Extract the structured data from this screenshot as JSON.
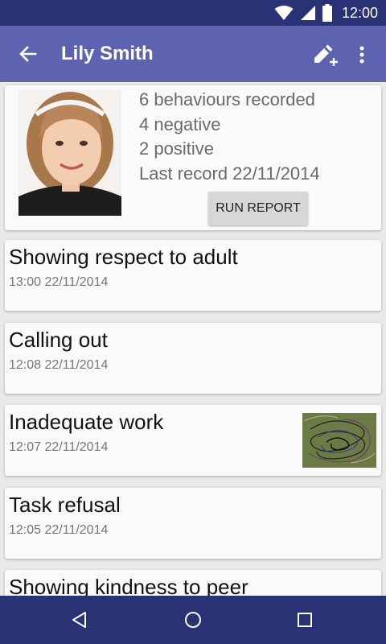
{
  "status_bar": {
    "time": "12:00"
  },
  "app_bar": {
    "title": "Lily Smith"
  },
  "profile": {
    "behaviours": "6 behaviours recorded",
    "negative": "4 negative",
    "positive": "2 positive",
    "last_record": "Last record 22/11/2014",
    "report_button": "RUN REPORT"
  },
  "records": [
    {
      "title": "Showing respect to adult",
      "time": "13:00 22/11/2014"
    },
    {
      "title": "Calling out",
      "time": "12:08 22/11/2014"
    },
    {
      "title": "Inadequate work",
      "time": "12:07 22/11/2014"
    },
    {
      "title": "Task refusal",
      "time": "12:05 22/11/2014"
    },
    {
      "title": "Showing kindness to peer",
      "time": ""
    }
  ],
  "colors": {
    "status_bar": "#2a3276",
    "app_bar": "#5d63b1",
    "background": "#e9e9e9",
    "card": "#fafafa"
  },
  "icons": [
    "wifi-icon",
    "signal-icon",
    "battery-icon",
    "back-arrow-icon",
    "add-record-icon",
    "more-vert-icon",
    "nav-back-icon",
    "nav-home-icon",
    "nav-recents-icon"
  ]
}
